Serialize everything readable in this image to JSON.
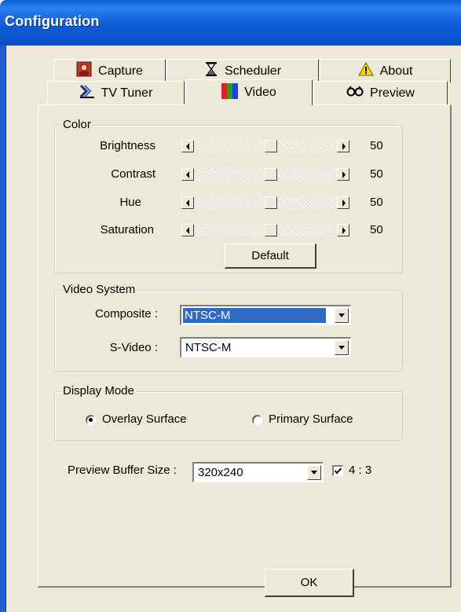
{
  "window": {
    "title": "Configuration"
  },
  "tabs": {
    "row1": [
      {
        "label": "Capture",
        "icon": "capture-icon"
      },
      {
        "label": "Scheduler",
        "icon": "hourglass-icon"
      },
      {
        "label": "About",
        "icon": "warning-icon"
      }
    ],
    "row2": [
      {
        "label": "TV Tuner",
        "icon": "tv-tuner-icon"
      },
      {
        "label": "Video",
        "icon": "video-color-bars-icon",
        "active": true
      },
      {
        "label": "Preview",
        "icon": "glasses-icon"
      }
    ]
  },
  "color_group": {
    "title": "Color",
    "sliders": [
      {
        "label": "Brightness",
        "value": "50"
      },
      {
        "label": "Contrast",
        "value": "50"
      },
      {
        "label": "Hue",
        "value": "50"
      },
      {
        "label": "Saturation",
        "value": "50"
      }
    ],
    "default_button": "Default"
  },
  "video_system": {
    "title": "Video System",
    "composite_label": "Composite :",
    "composite_value": "NTSC-M",
    "svideo_label": "S-Video :",
    "svideo_value": "NTSC-M"
  },
  "display_mode": {
    "title": "Display Mode",
    "overlay_label": "Overlay Surface",
    "primary_label": "Primary Surface",
    "selected": "Overlay Surface"
  },
  "preview": {
    "buffer_label": "Preview Buffer Size :",
    "buffer_value": "320x240",
    "aspect_label": "4 : 3",
    "aspect_checked": true
  },
  "ok_button": "OK",
  "colors": {
    "title_bar": "#0a5fd8",
    "dialog_bg": "#ece9d8",
    "selection": "#316ac5"
  }
}
